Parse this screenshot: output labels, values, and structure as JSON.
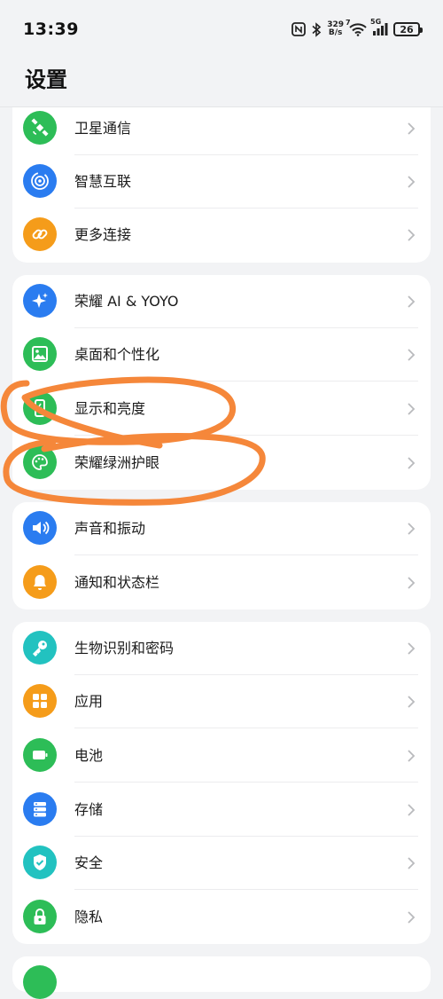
{
  "status_bar": {
    "time": "13:39",
    "net_speed_value": "329",
    "net_speed_unit": "B/s",
    "wifi_badge": "7",
    "signal_label": "5G",
    "battery": "26"
  },
  "header": {
    "title": "设置"
  },
  "groups": [
    {
      "items": [
        {
          "label": "卫星通信",
          "icon": "satellite-icon",
          "color": "#2dbd57"
        },
        {
          "label": "智慧互联",
          "icon": "smart-connect-icon",
          "color": "#2a7cf0"
        },
        {
          "label": "更多连接",
          "icon": "link-icon",
          "color": "#f59c1a"
        }
      ]
    },
    {
      "items": [
        {
          "label": "荣耀 AI & YOYO",
          "icon": "sparkle-icon",
          "color": "#2a7cf0"
        },
        {
          "label": "桌面和个性化",
          "icon": "picture-icon",
          "color": "#2dbd57"
        },
        {
          "label": "显示和亮度",
          "icon": "phone-brightness-icon",
          "color": "#2dbd57"
        },
        {
          "label": "荣耀绿洲护眼",
          "icon": "palette-icon",
          "color": "#2dbd57"
        }
      ]
    },
    {
      "items": [
        {
          "label": "声音和振动",
          "icon": "speaker-icon",
          "color": "#2a7cf0"
        },
        {
          "label": "通知和状态栏",
          "icon": "bell-icon",
          "color": "#f59c1a"
        }
      ]
    },
    {
      "items": [
        {
          "label": "生物识别和密码",
          "icon": "key-icon",
          "color": "#22c2c0"
        },
        {
          "label": "应用",
          "icon": "grid-icon",
          "color": "#f59c1a"
        },
        {
          "label": "电池",
          "icon": "battery-icon",
          "color": "#2dbd57"
        },
        {
          "label": "存储",
          "icon": "storage-icon",
          "color": "#2a7cf0"
        },
        {
          "label": "安全",
          "icon": "shield-icon",
          "color": "#22c2c0"
        },
        {
          "label": "隐私",
          "icon": "lock-icon",
          "color": "#2dbd57"
        }
      ]
    }
  ],
  "annotation_color": "#f5873a"
}
